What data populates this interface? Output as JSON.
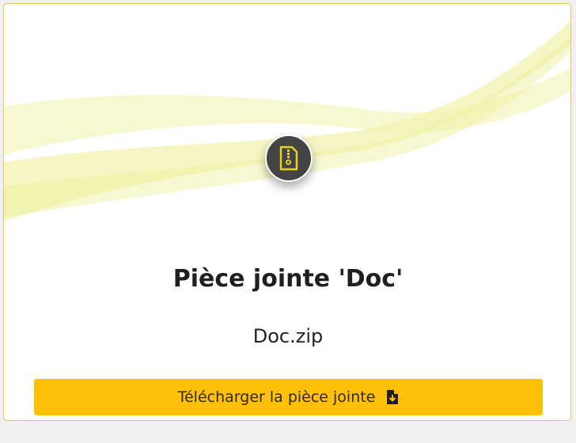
{
  "attachment": {
    "title": "Pièce jointe 'Doc'",
    "file_name": "Doc.zip",
    "icon": "zip-file-icon"
  },
  "actions": {
    "download_label": "Télécharger la pièce jointe",
    "download_icon": "file-download-icon"
  },
  "colors": {
    "accent": "#ffc107",
    "avatar_background": "#444444",
    "icon_color": "#e8d21d",
    "border": "#e3c766"
  }
}
